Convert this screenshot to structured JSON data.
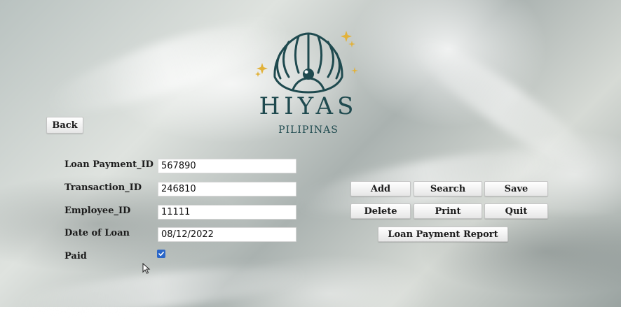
{
  "brand": {
    "name": "HIYAS",
    "subtitle": "PILIPINAS"
  },
  "nav": {
    "back_label": "Back"
  },
  "form": {
    "loan_payment_id": {
      "label": "Loan Payment_ID",
      "value": "567890"
    },
    "transaction_id": {
      "label": "Transaction_ID",
      "value": "246810"
    },
    "employee_id": {
      "label": "Employee_ID",
      "value": "11111"
    },
    "date_of_loan": {
      "label": "Date of Loan",
      "value": "08/12/2022"
    },
    "paid": {
      "label": "Paid",
      "checked": true
    }
  },
  "actions": {
    "add": "Add",
    "search": "Search",
    "save": "Save",
    "delete": "Delete",
    "print": "Print",
    "quit": "Quit",
    "report": "Loan Payment Report"
  },
  "colors": {
    "brand": "#1f4a4f",
    "accent_gold": "#e2b23a",
    "checkbox": "#2a66c8"
  }
}
